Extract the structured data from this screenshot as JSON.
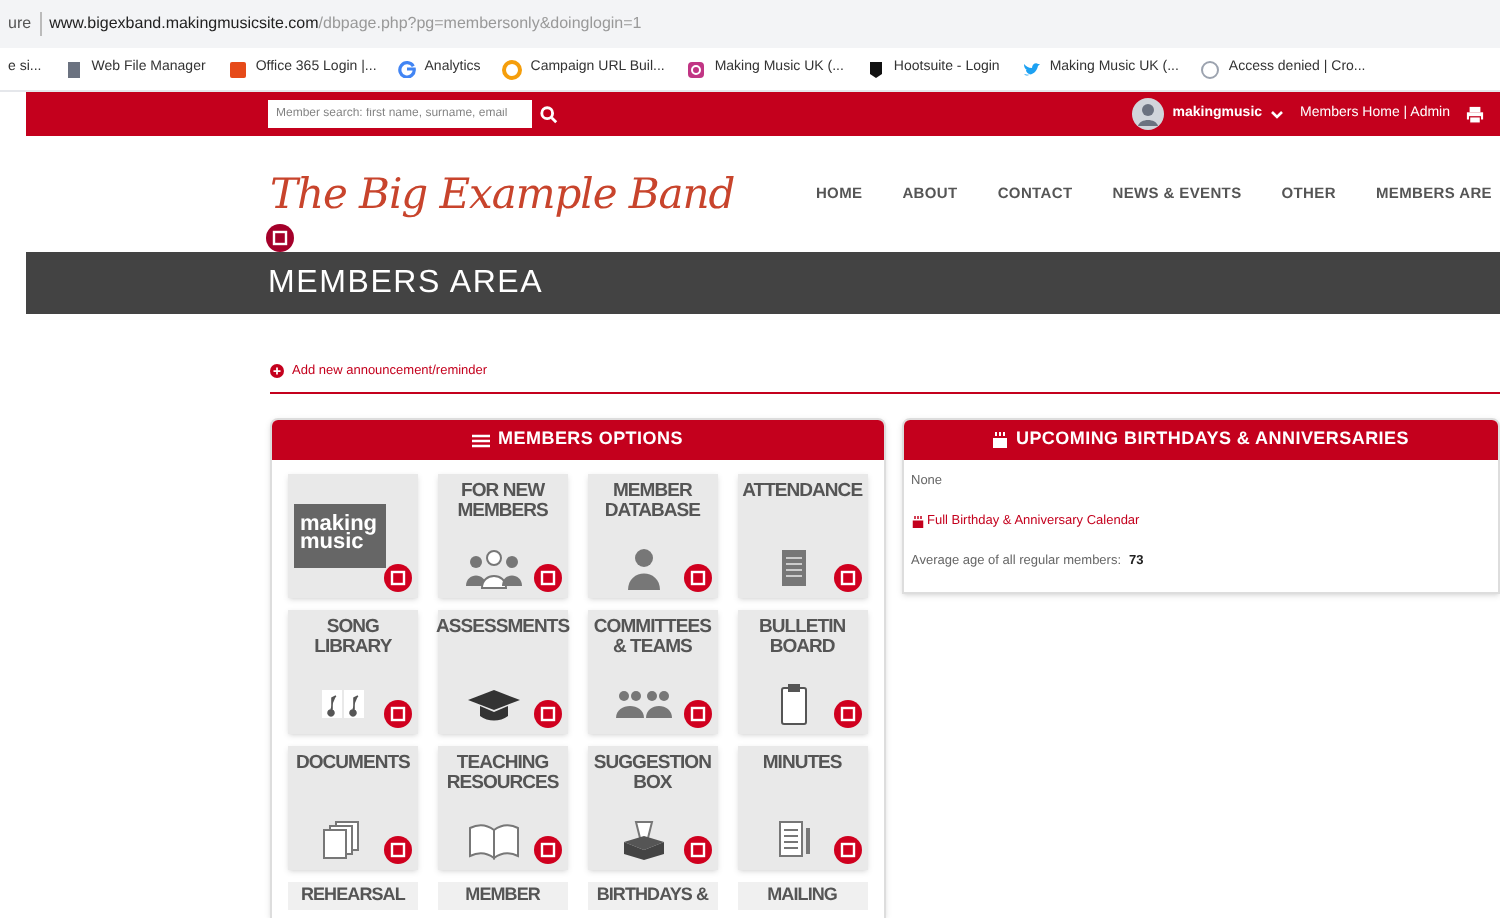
{
  "browser": {
    "tab_fragment": "ure",
    "url_host": "www.bigexband.makingmusicsite.com",
    "url_path": "/dbpage.php?pg=membersonly&doinglogin=1",
    "bookmarks": [
      {
        "kind": "partial",
        "label": "e si..."
      },
      {
        "kind": "page",
        "label": "Web File Manager"
      },
      {
        "kind": "office",
        "label": "Office 365 Login |..."
      },
      {
        "kind": "google",
        "label": "Analytics"
      },
      {
        "kind": "campaign",
        "label": "Campaign URL Buil..."
      },
      {
        "kind": "instagram",
        "label": "Making Music UK (..."
      },
      {
        "kind": "hootsuite",
        "label": "Hootsuite - Login"
      },
      {
        "kind": "twitter",
        "label": "Making Music UK (..."
      },
      {
        "kind": "denied",
        "label": "Access denied | Cro..."
      }
    ]
  },
  "topbar": {
    "search_placeholder": "Member search: first name, surname, email",
    "username": "makingmusic",
    "links": "Members Home | Admin"
  },
  "site": {
    "logo": "The Big Example Band",
    "nav": [
      {
        "label": "HOME"
      },
      {
        "label": "ABOUT"
      },
      {
        "label": "CONTACT"
      },
      {
        "label": "NEWS & EVENTS"
      },
      {
        "label": "OTHER"
      },
      {
        "label": "MEMBERS ARE"
      }
    ]
  },
  "page_title": "MEMBERS AREA",
  "announcement_link": "Add new announcement/reminder",
  "options_panel": {
    "title": "MEMBERS OPTIONS",
    "tiles": [
      {
        "kind": "logo",
        "logo": "making\nmusic"
      },
      {
        "kind": "people",
        "title": "FOR NEW\nMEMBERS"
      },
      {
        "kind": "person",
        "title": "MEMBER\nDATABASE"
      },
      {
        "kind": "register",
        "title": "ATTENDANCE"
      },
      {
        "kind": "sheets",
        "title": "SONG\nLIBRARY"
      },
      {
        "kind": "cap",
        "title": "ASSESSMENTS"
      },
      {
        "kind": "teams",
        "title": "COMMITTEES\n& TEAMS"
      },
      {
        "kind": "clipboard",
        "title": "BULLETIN\nBOARD"
      },
      {
        "kind": "pages",
        "title": "DOCUMENTS"
      },
      {
        "kind": "book",
        "title": "TEACHING\nRESOURCES"
      },
      {
        "kind": "ballot",
        "title": "SUGGESTION\nBOX"
      },
      {
        "kind": "minutes",
        "title": "MINUTES"
      },
      {
        "kind": "cut",
        "title": "REHEARSAL"
      },
      {
        "kind": "cut",
        "title": "MEMBER"
      },
      {
        "kind": "cut",
        "title": "BIRTHDAYS &"
      },
      {
        "kind": "cut",
        "title": "MAILING"
      }
    ]
  },
  "birthdays_panel": {
    "title": "UPCOMING BIRTHDAYS & ANNIVERSARIES",
    "none_text": "None",
    "calendar_link": "Full Birthday & Anniversary Calendar",
    "average_label": "Average age of all regular members:",
    "average_value": "73"
  }
}
